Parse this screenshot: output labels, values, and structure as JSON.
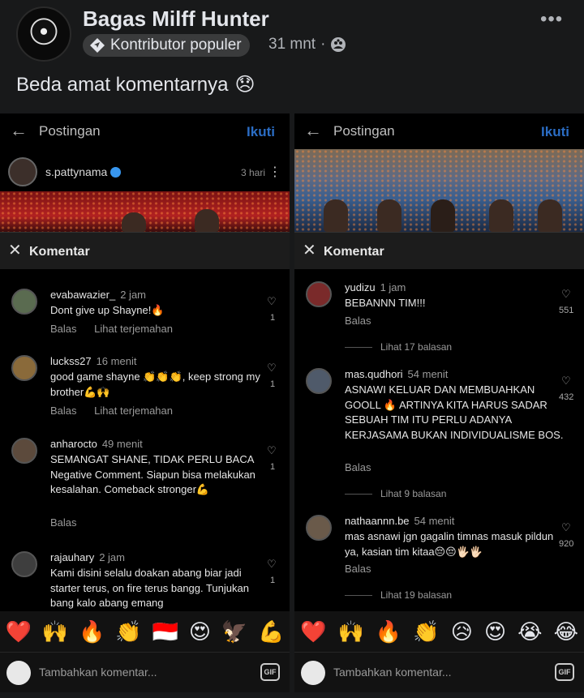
{
  "post": {
    "author": "Bagas Milff Hunter",
    "badge": "Kontributor populer",
    "time": "31 mnt",
    "separator": "·",
    "more": "•••",
    "text": "Beda amat komentarnya",
    "text_emoji": "😞"
  },
  "left_screenshot": {
    "back": "←",
    "title": "Postingan",
    "follow": "Ikuti",
    "ig_user": "s.pattynama",
    "ig_time": "3 hari",
    "ig_more": "⋮",
    "comments_title": "Komentar",
    "close": "✕",
    "comments": [
      {
        "user": "evabawazier_",
        "time": "2 jam",
        "text": "Dont give up Shayne!🔥",
        "actions": [
          "Balas",
          "Lihat terjemahan"
        ],
        "likes": "1"
      },
      {
        "user": "luckss27",
        "time": "16 menit",
        "text": "good game shayne 👏👏👏, keep strong my brother💪🙌",
        "actions": [
          "Balas",
          "Lihat terjemahan"
        ],
        "likes": "1"
      },
      {
        "user": "anharocto",
        "time": "49 menit",
        "text": "SEMANGAT SHANE, TIDAK PERLU BACA Negative Comment. Siapun bisa melakukan kesalahan. Comeback stronger💪",
        "actions": [
          "Balas"
        ],
        "likes": "1"
      },
      {
        "user": "rajauhary",
        "time": "2 jam",
        "text": "Kami disini selalu doakan abang biar jadi starter terus, on fire terus bangg. Tunjukan bang kalo abang emang",
        "actions": [],
        "likes": "1"
      }
    ],
    "reactions": [
      "❤️",
      "🙌",
      "🔥",
      "👏",
      "🇮🇩",
      "😍",
      "🦅",
      "💪"
    ],
    "add_placeholder": "Tambahkan komentar...",
    "gif": "GIF"
  },
  "right_screenshot": {
    "back": "←",
    "title": "Postingan",
    "follow": "Ikuti",
    "comments_title": "Komentar",
    "close": "✕",
    "comments": [
      {
        "user": "yudizu",
        "time": "1 jam",
        "text": "BEBANNN TIM!!!",
        "actions": [
          "Balas"
        ],
        "likes": "551",
        "replies": "Lihat 17 balasan"
      },
      {
        "user": "mas.qudhori",
        "time": "54 menit",
        "text": "ASNAWI KELUAR DAN MEMBUAHKAN GOOLL 🔥 ARTINYA KITA HARUS SADAR SEBUAH TIM ITU PERLU ADANYA KERJASAMA BUKAN INDIVIDUALISME BOS.",
        "actions": [
          "Balas"
        ],
        "likes": "432",
        "replies": "Lihat 9 balasan"
      },
      {
        "user": "nathaannn.be",
        "time": "54 menit",
        "text": "mas asnawi jgn gagalin timnas masuk pildun ya, kasian tim kitaa😔😔🖐🏻🖐🏻",
        "actions": [
          "Balas"
        ],
        "likes": "920",
        "replies": "Lihat 19 balasan"
      }
    ],
    "reactions": [
      "❤️",
      "🙌",
      "🔥",
      "👏",
      "😥",
      "😍",
      "😭",
      "😂"
    ],
    "add_placeholder": "Tambahkan komentar...",
    "gif": "GIF"
  }
}
